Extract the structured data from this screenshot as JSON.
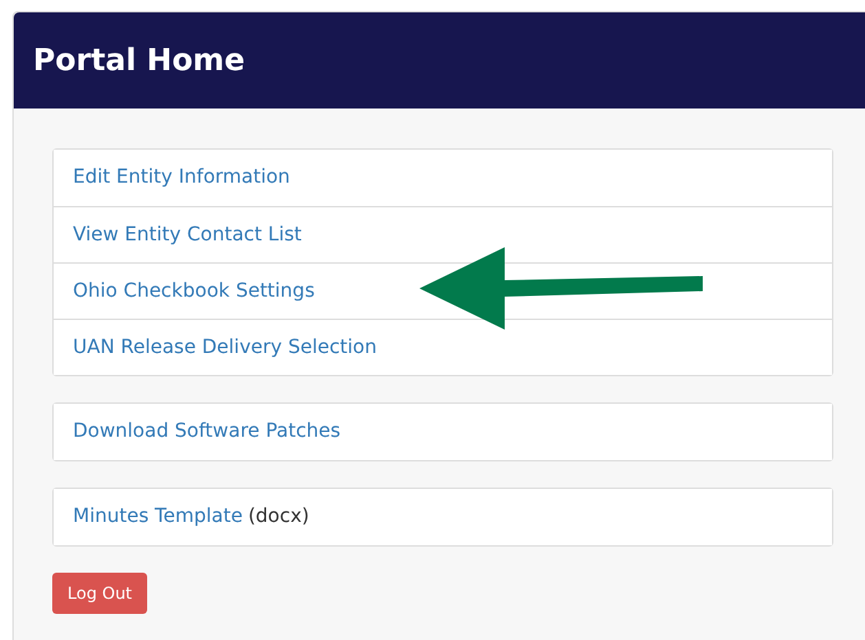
{
  "panel": {
    "title": "Portal Home"
  },
  "link_groups": [
    [
      {
        "label": "Edit Entity Information"
      },
      {
        "label": "View Entity Contact List"
      },
      {
        "label": "Ohio Checkbook Settings"
      },
      {
        "label": "UAN Release Delivery Selection"
      }
    ],
    [
      {
        "label": "Download Software Patches"
      }
    ],
    [
      {
        "label": "Minutes Template",
        "note": "(docx)"
      }
    ]
  ],
  "logout_button": "Log Out"
}
